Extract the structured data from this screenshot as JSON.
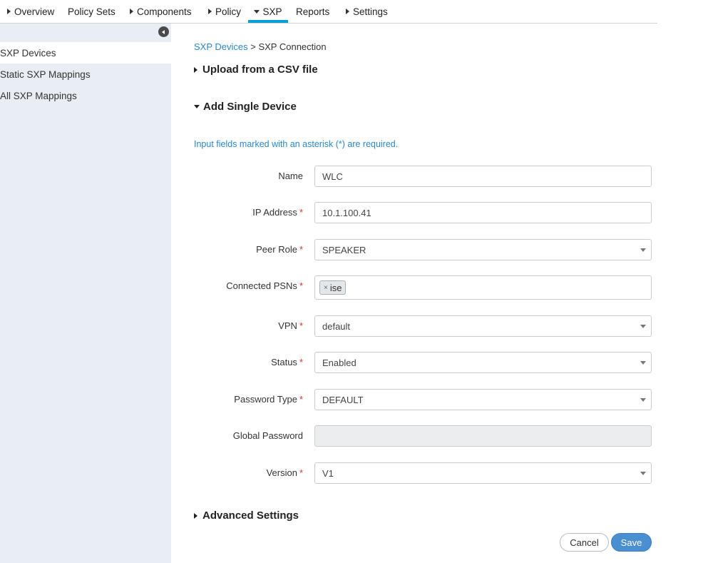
{
  "nav": {
    "tabs": [
      {
        "label": "Overview",
        "caret": "right"
      },
      {
        "label": "Policy Sets",
        "caret": "none"
      },
      {
        "label": "Components",
        "caret": "right"
      },
      {
        "label": "Policy",
        "caret": "right"
      },
      {
        "label": "SXP",
        "caret": "down",
        "active": true
      },
      {
        "label": "Reports",
        "caret": "none"
      },
      {
        "label": "Settings",
        "caret": "right"
      }
    ],
    "accent_color": "#049fd9"
  },
  "sidebar": {
    "collapse_icon": "chevron-left-circle-icon",
    "items": [
      {
        "label": "SXP Devices",
        "active": true
      },
      {
        "label": "Static SXP Mappings"
      },
      {
        "label": "All SXP Mappings"
      }
    ]
  },
  "breadcrumb": {
    "link": "SXP Devices",
    "separator": " > ",
    "current": "SXP Connection"
  },
  "sections": {
    "upload": "Upload from a CSV file",
    "add_single": "Add Single Device",
    "advanced": "Advanced Settings"
  },
  "required_note": "Input fields marked with an asterisk (*) are required.",
  "form": {
    "required_marker": "*",
    "name": {
      "label": "Name",
      "value": "WLC"
    },
    "ip": {
      "label": "IP Address",
      "value": "10.1.100.41"
    },
    "peer_role": {
      "label": "Peer Role",
      "value": "SPEAKER"
    },
    "psns": {
      "label": "Connected PSNs",
      "chip": "ise",
      "chip_remove": "×"
    },
    "vpn": {
      "label": "VPN",
      "value": "default"
    },
    "status": {
      "label": "Status",
      "value": "Enabled"
    },
    "password_type": {
      "label": "Password Type",
      "value": "DEFAULT"
    },
    "global_password": {
      "label": "Global Password",
      "value": ""
    },
    "version": {
      "label": "Version",
      "value": "V1"
    }
  },
  "buttons": {
    "cancel": "Cancel",
    "save": "Save"
  },
  "colors": {
    "link": "#2a87c8",
    "required": "#d9372b",
    "save_button": "#4a8fd1",
    "sidebar_bg": "#e9eef4"
  }
}
